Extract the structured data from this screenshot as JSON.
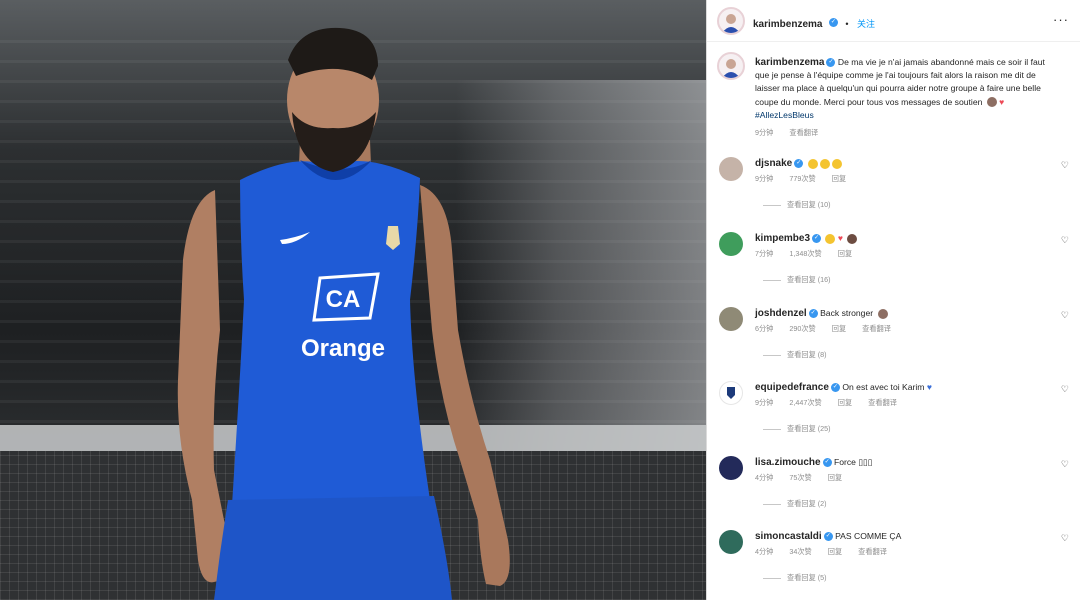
{
  "post": {
    "username": "karimbenzema",
    "follow_label": "关注",
    "more_label": "···",
    "caption_user": "karimbenzema",
    "caption_text": "De ma vie je n'ai jamais abandonné mais ce soir il faut que je pense à l'équipe comme je l'ai toujours fait alors la raison me dit de laisser ma place à quelqu'un qui pourra aider notre groupe à faire une belle coupe du monde. Merci pour tous vos messages de soutien",
    "caption_hashtag": "#AllezLesBleus",
    "caption_time": "9分钟",
    "caption_translate": "查看翻译",
    "photo_text": "Orange"
  },
  "comments": [
    {
      "username": "djsnake",
      "verified": true,
      "text": "",
      "time": "9分钟",
      "likes": "779次赞",
      "reply": "回复",
      "translate": "",
      "replies": "查看回复 (10)"
    },
    {
      "username": "kimpembe3",
      "verified": true,
      "text": "",
      "time": "7分钟",
      "likes": "1,348次赞",
      "reply": "回复",
      "translate": "",
      "replies": "查看回复 (16)"
    },
    {
      "username": "joshdenzel",
      "verified": true,
      "text": "Back stronger",
      "time": "6分钟",
      "likes": "290次赞",
      "reply": "回复",
      "translate": "查看翻译",
      "replies": "查看回复 (8)"
    },
    {
      "username": "equipedefrance",
      "verified": true,
      "text": "On est avec toi Karim",
      "time": "9分钟",
      "likes": "2,447次赞",
      "reply": "回复",
      "translate": "查看翻译",
      "replies": "查看回复 (25)"
    },
    {
      "username": "lisa.zimouche",
      "verified": true,
      "text": "Force ▯▯▯",
      "time": "4分钟",
      "likes": "75次赞",
      "reply": "回复",
      "translate": "",
      "replies": "查看回复 (2)"
    },
    {
      "username": "simoncastaldi",
      "verified": true,
      "text": "PAS COMME ÇA",
      "time": "4分钟",
      "likes": "34次赞",
      "reply": "回复",
      "translate": "查看翻译",
      "replies": "查看回复 (5)"
    }
  ],
  "icons": {
    "verified": "verified-badge-icon",
    "heart": "heart-outline-icon",
    "more": "more-options-icon"
  },
  "colors": {
    "link_blue": "#0095f6",
    "verified_blue": "#3897f0",
    "jersey_blue": "#1f5bd6",
    "heart_red": "#ed4956",
    "muted_gray": "#8e8e8e"
  }
}
